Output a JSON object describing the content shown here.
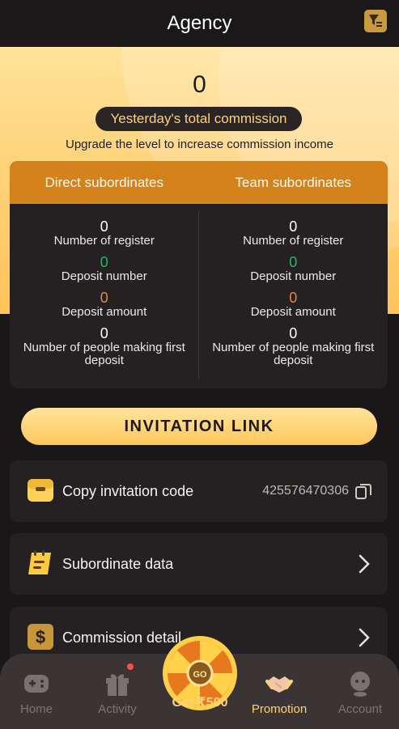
{
  "header": {
    "title": "Agency",
    "filter_icon": "filter-icon"
  },
  "hero": {
    "commission_value": "0",
    "commission_label": "Yesterday's total commission",
    "upgrade_text": "Upgrade the level to increase commission income"
  },
  "stats": {
    "direct_title": "Direct subordinates",
    "team_title": "Team subordinates",
    "direct": [
      {
        "value": "0",
        "label": "Number of register"
      },
      {
        "value": "0",
        "label": "Deposit number"
      },
      {
        "value": "0",
        "label": "Deposit amount"
      },
      {
        "value": "0",
        "label": "Number of people making first deposit"
      }
    ],
    "team": [
      {
        "value": "0",
        "label": "Number of register"
      },
      {
        "value": "0",
        "label": "Deposit number"
      },
      {
        "value": "0",
        "label": "Deposit amount"
      },
      {
        "value": "0",
        "label": "Number of people making first deposit"
      }
    ]
  },
  "invite_button": "INVITATION LINK",
  "rows": {
    "copy_code": {
      "label": "Copy invitation code",
      "value": "425576470306"
    },
    "subordinate": {
      "label": "Subordinate data"
    },
    "commission": {
      "label": "Commission detail"
    }
  },
  "tabbar": {
    "home": "Home",
    "activity": "Activity",
    "wheel": "Get ₹500",
    "wheel_go": "GO",
    "promotion": "Promotion",
    "account": "Account"
  },
  "colors": {
    "accent": "#ffd27a",
    "orange_header": "#d4821c",
    "green_value": "#1eb96a",
    "orange_value": "#e3893b",
    "card_bg": "#252122",
    "page_bg": "#1a1718"
  }
}
